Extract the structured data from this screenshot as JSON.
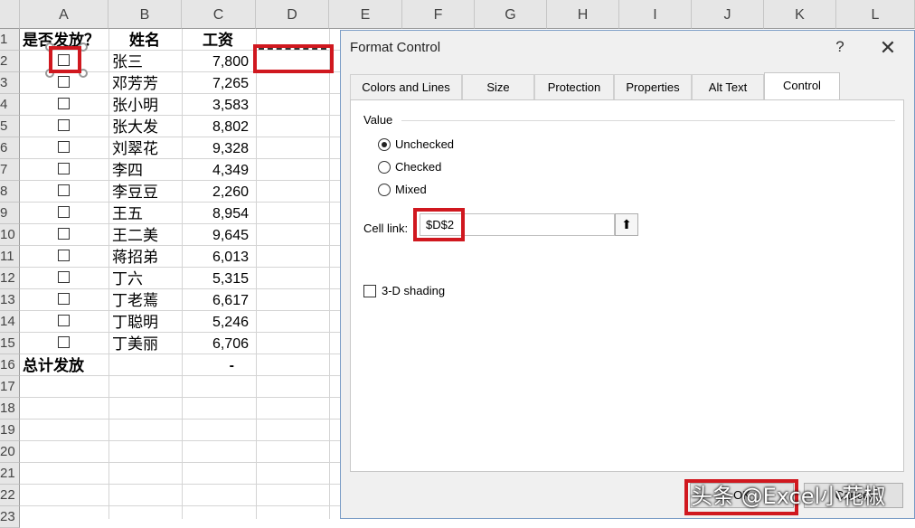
{
  "columns": [
    "A",
    "B",
    "C",
    "D",
    "E",
    "F",
    "G",
    "H",
    "I",
    "J",
    "K",
    "L"
  ],
  "rows": [
    "1",
    "2",
    "3",
    "4",
    "5",
    "6",
    "7",
    "8",
    "9",
    "10",
    "11",
    "12",
    "13",
    "14",
    "15",
    "16",
    "17",
    "18",
    "19",
    "20",
    "21",
    "22",
    "23"
  ],
  "headers": {
    "issued": "是否发放？",
    "name": "姓名",
    "salary": "工资"
  },
  "employees": [
    {
      "name": "张三",
      "salary": "7,800"
    },
    {
      "name": "邓芳芳",
      "salary": "7,265"
    },
    {
      "name": "张小明",
      "salary": "3,583"
    },
    {
      "name": "张大发",
      "salary": "8,802"
    },
    {
      "name": "刘翠花",
      "salary": "9,328"
    },
    {
      "name": "李四",
      "salary": "4,349"
    },
    {
      "name": "李豆豆",
      "salary": "2,260"
    },
    {
      "name": "王五",
      "salary": "8,954"
    },
    {
      "name": "王二美",
      "salary": "9,645"
    },
    {
      "name": "蒋招弟",
      "salary": "6,013"
    },
    {
      "name": "丁六",
      "salary": "5,315"
    },
    {
      "name": "丁老蔫",
      "salary": "6,617"
    },
    {
      "name": "丁聪明",
      "salary": "5,246"
    },
    {
      "name": "丁美丽",
      "salary": "6,706"
    }
  ],
  "total": {
    "label": "总计发放",
    "value": "-"
  },
  "dialog": {
    "title": "Format Control",
    "help": "?",
    "close": "✕",
    "tabs": [
      "Colors and Lines",
      "Size",
      "Protection",
      "Properties",
      "Alt Text",
      "Control"
    ],
    "active_tab": "Control",
    "value_group": "Value",
    "radios": [
      "Unchecked",
      "Checked",
      "Mixed"
    ],
    "selected_radio": "Unchecked",
    "cell_link_label": "Cell link:",
    "cell_link_value": "$D$2",
    "collapse_icon": "⬆",
    "shading_label": "3-D shading",
    "ok_label": "OK",
    "cancel_label": "Cancel"
  },
  "watermark": "头条 @Excel小花椒",
  "colors": {
    "highlight": "#d0181f"
  }
}
